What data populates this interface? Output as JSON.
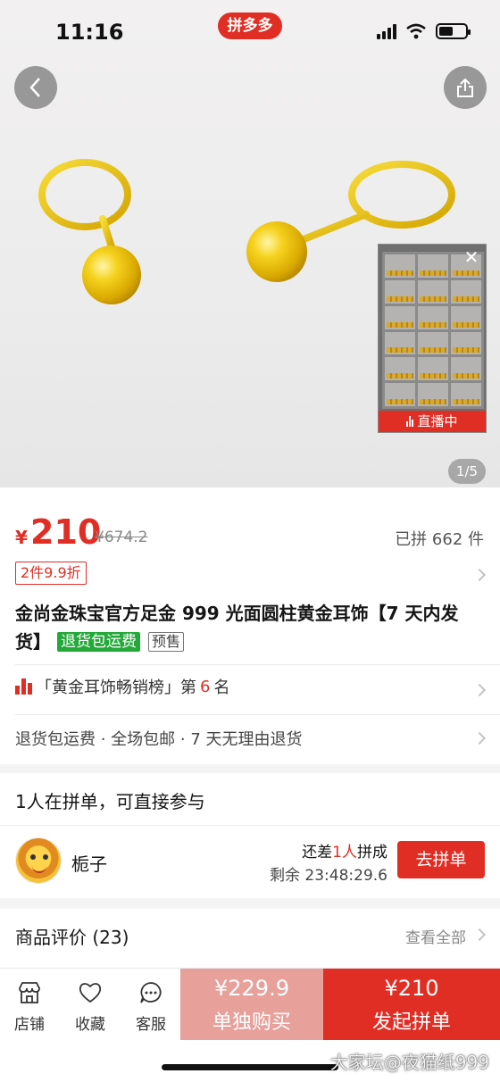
{
  "status": {
    "time": "11:16",
    "app_badge": "拼多多"
  },
  "gallery": {
    "page_indicator": "1/5",
    "live_label": "直播中"
  },
  "price": {
    "currency": "¥",
    "current": "210",
    "original": "¥674.2",
    "sold": "已拼 662 件",
    "discount_tag": "2件9.9折"
  },
  "product": {
    "title": "金尚金珠宝官方足金 999 光面圆柱黄金耳饰【7 天内发货】",
    "tag_return": "退货包运费",
    "tag_presale": "预售"
  },
  "ranking": {
    "prefix": "「黄金耳饰畅销榜」第",
    "number": "6",
    "suffix": "名"
  },
  "services": {
    "text": "退货包运费 · 全场包邮 · 7 天无理由退货"
  },
  "group": {
    "title": "1人在拼单，可直接参与",
    "user_name": "栀子",
    "need_prefix": "还差",
    "need_count": "1人",
    "need_suffix": "拼成",
    "remaining": "剩余 23:48:29.6",
    "join_label": "去拼单"
  },
  "reviews": {
    "title": "商品评价 (23)",
    "view_all": "查看全部"
  },
  "bottom_bar": {
    "nav": [
      {
        "label": "店铺",
        "icon": "store-icon"
      },
      {
        "label": "收藏",
        "icon": "heart-icon"
      },
      {
        "label": "客服",
        "icon": "chat-icon"
      }
    ],
    "buy_alone_price": "¥229.9",
    "buy_alone_label": "单独购买",
    "buy_group_price": "¥210",
    "buy_group_label": "发起拼单"
  },
  "watermark": "大家坛@夜猫纸999",
  "colors": {
    "accent": "#e02e24",
    "green_tag": "#24a83a",
    "buy_alone_bg": "#e8a09b"
  }
}
